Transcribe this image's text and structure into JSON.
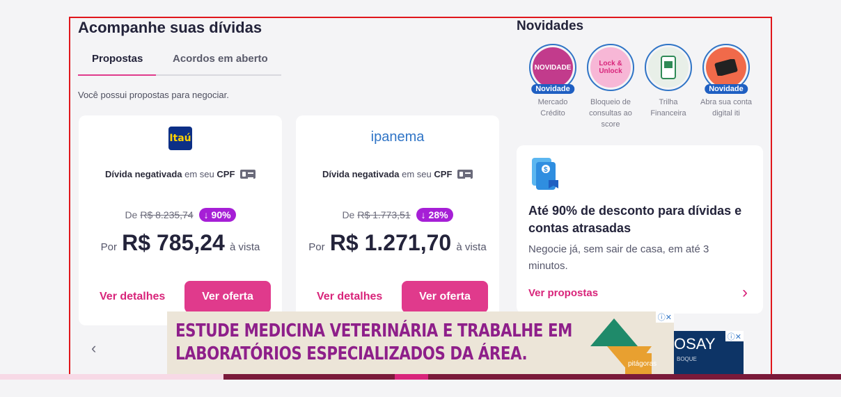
{
  "section": {
    "title": "Acompanhe suas dívidas"
  },
  "tabs": [
    {
      "label": "Propostas",
      "active": true
    },
    {
      "label": "Acordos em aberto",
      "active": false
    }
  ],
  "subtitle": "Você possui propostas para negociar.",
  "cards": [
    {
      "logo": "Itaú",
      "debt_bold": "Dívida negativada",
      "debt_mid": "em seu",
      "debt_cpf": "CPF",
      "from_label": "De",
      "old_price": "R$ 8.235,74",
      "discount": "↓ 90%",
      "price_prefix": "Por",
      "price": "R$ 785,24",
      "price_suffix": "à vista",
      "details_label": "Ver detalhes",
      "offer_label": "Ver oferta"
    },
    {
      "logo": "ipanema",
      "debt_bold": "Dívida negativada",
      "debt_mid": "em seu",
      "debt_cpf": "CPF",
      "from_label": "De",
      "old_price": "R$ 1.773,51",
      "discount": "↓ 28%",
      "price_prefix": "Por",
      "price": "R$ 1.271,70",
      "price_suffix": "à vista",
      "details_label": "Ver detalhes",
      "offer_label": "Ver oferta"
    }
  ],
  "carousel": {
    "prev_icon": "‹"
  },
  "news": {
    "title": "Novidades",
    "stories": [
      {
        "label": "Mercado Crédito",
        "badge": "Novidade",
        "image_text": "NOVIDADE",
        "color": "#c23b8c"
      },
      {
        "label": "Bloqueio de consultas ao score",
        "badge": "",
        "image_text": "Lock & Unlock",
        "color": "#f7b7d6"
      },
      {
        "label": "Trilha Financeira",
        "badge": "",
        "image_text": "",
        "color": "#e8efe8"
      },
      {
        "label": "Abra sua conta digital iti",
        "badge": "Novidade",
        "image_text": "",
        "color": "#f06a4a"
      }
    ]
  },
  "promo": {
    "heading": "Até 90% de desconto para dívidas e contas atrasadas",
    "body": "Negocie já, sem sair de casa, em até 3 minutos.",
    "link": "Ver propostas",
    "chevron": "›"
  },
  "ads": {
    "main_line1": "ESTUDE MEDICINA VETERINÁRIA E TRABALHE EM",
    "main_line2": "LABORATÓRIOS ESPECIALIZADOS DA ÁREA.",
    "main_brand": "pitágoras",
    "main_close": "ⓘ✕",
    "side_text": "OSAY",
    "side_sub": "BOQUE",
    "side_close": "ⓘ✕"
  },
  "colors": {
    "accent": "#e03a8c",
    "link": "#d8247a",
    "discount": "#a61fd6",
    "frame": "#e0161b"
  }
}
